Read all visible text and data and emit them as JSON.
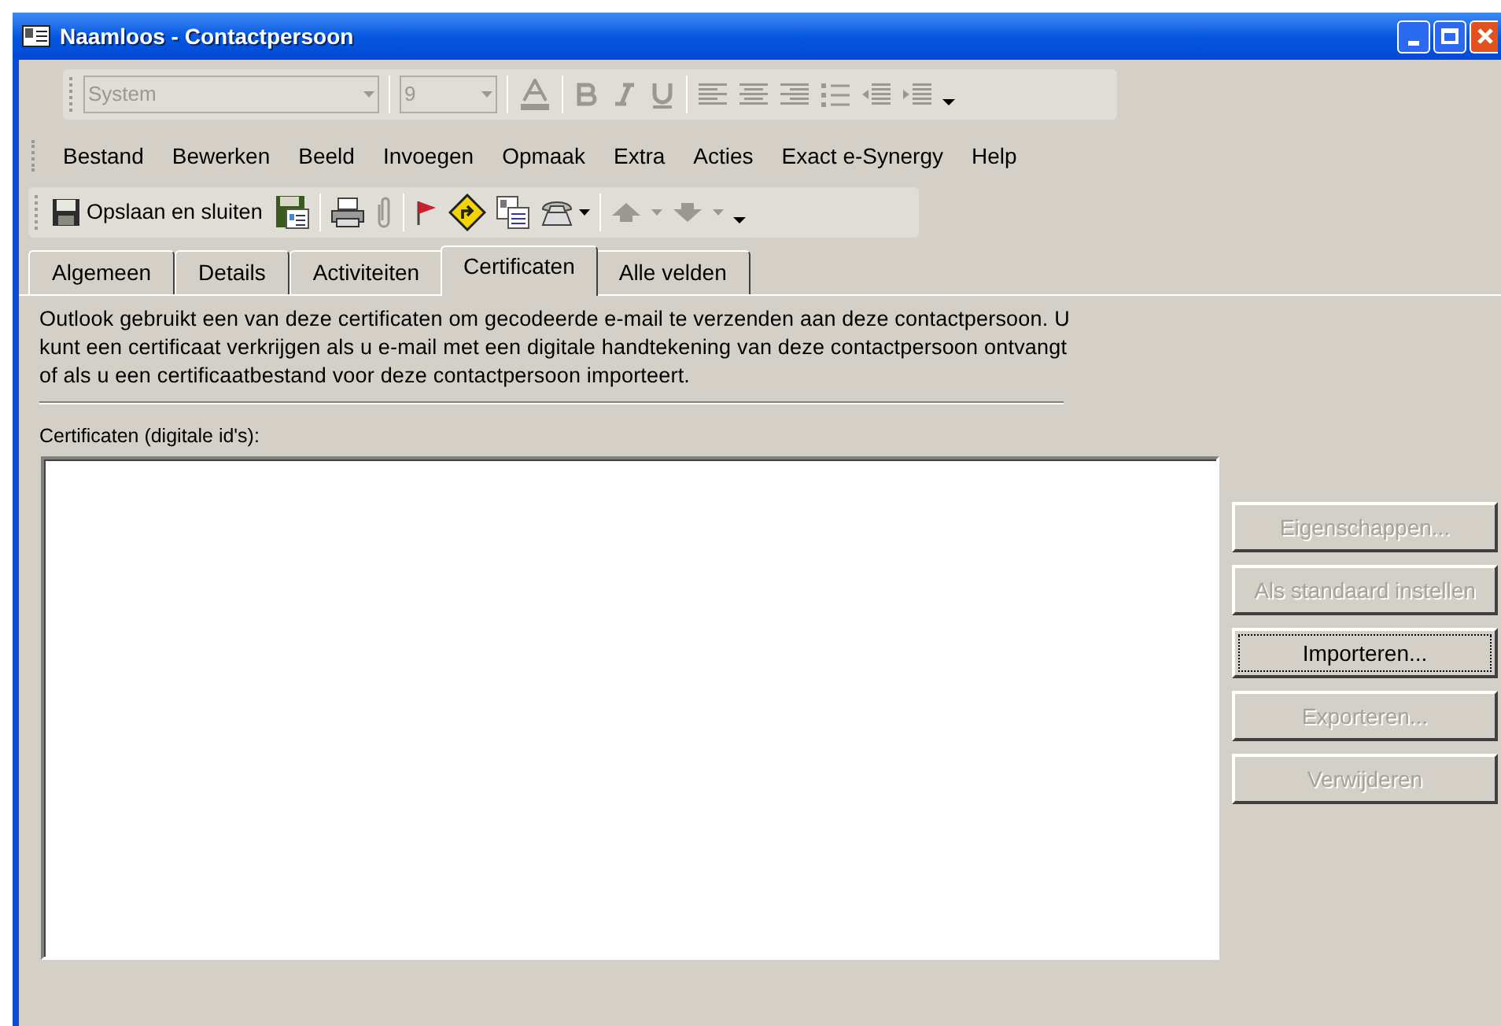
{
  "window": {
    "title": "Naamloos - Contactpersoon"
  },
  "format_toolbar": {
    "disabled": true,
    "font": "System",
    "size": "9"
  },
  "menu": [
    {
      "label": "Bestand"
    },
    {
      "label": "Bewerken"
    },
    {
      "label": "Beeld"
    },
    {
      "label": "Invoegen"
    },
    {
      "label": "Opmaak"
    },
    {
      "label": "Extra"
    },
    {
      "label": "Acties"
    },
    {
      "label": "Exact e-Synergy"
    },
    {
      "label": "Help"
    }
  ],
  "standard_toolbar": {
    "save_button": "Opslaan en sluiten"
  },
  "tabs": [
    {
      "label": "Algemeen",
      "selected": false
    },
    {
      "label": "Details",
      "selected": false
    },
    {
      "label": "Activiteiten",
      "selected": false
    },
    {
      "label": "Certificaten",
      "selected": true
    },
    {
      "label": "Alle velden",
      "selected": false
    }
  ],
  "description": "Outlook gebruikt een van deze certificaten om gecodeerde e-mail te verzenden aan deze contactpersoon. U kunt een certificaat verkrijgen als u e-mail met een digitale handtekening van deze contactpersoon ontvangt of als u een certificaatbestand voor deze contactpersoon importeert.",
  "certificates_label": "Certificaten (digitale id's):",
  "buttons": [
    {
      "label": "Eigenschappen...",
      "disabled": true,
      "focused": false
    },
    {
      "label": "Als standaard instellen",
      "disabled": true,
      "focused": false
    },
    {
      "label": "Importeren...",
      "disabled": false,
      "focused": true
    },
    {
      "label": "Exporteren...",
      "disabled": true,
      "focused": false
    },
    {
      "label": "Verwijderen",
      "disabled": true,
      "focused": false
    }
  ]
}
